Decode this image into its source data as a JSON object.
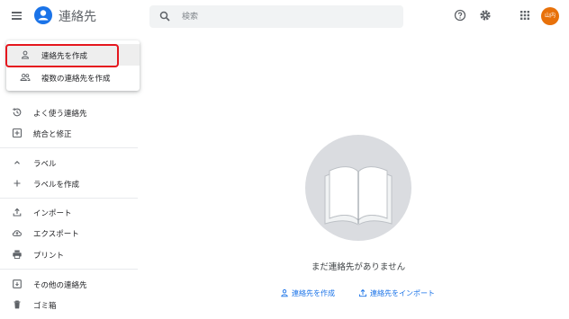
{
  "header": {
    "app_title": "連絡先",
    "search_placeholder": "検索",
    "avatar_text": "山内"
  },
  "dropdown": {
    "items": [
      {
        "label": "連絡先を作成",
        "icon": "person-outline-icon"
      },
      {
        "label": "複数の連絡先を作成",
        "icon": "people-outline-icon"
      }
    ]
  },
  "sidebar": {
    "items": [
      {
        "label": "よく使う連絡先",
        "icon": "history-icon"
      },
      {
        "label": "統合と修正",
        "icon": "merge-fix-icon"
      },
      {
        "label": "ラベル",
        "icon": "chevron-up-icon"
      },
      {
        "label": "ラベルを作成",
        "icon": "plus-icon"
      },
      {
        "label": "インポート",
        "icon": "upload-icon"
      },
      {
        "label": "エクスポート",
        "icon": "cloud-upload-icon"
      },
      {
        "label": "プリント",
        "icon": "print-icon"
      },
      {
        "label": "その他の連絡先",
        "icon": "archive-icon"
      },
      {
        "label": "ゴミ箱",
        "icon": "trash-icon"
      }
    ]
  },
  "main": {
    "empty_message": "まだ連絡先がありません",
    "create_link": "連絡先を作成",
    "import_link": "連絡先をインポート"
  },
  "colors": {
    "accent": "#1a73e8",
    "highlight_border": "#e5161e",
    "avatar_bg": "#e8710a"
  }
}
